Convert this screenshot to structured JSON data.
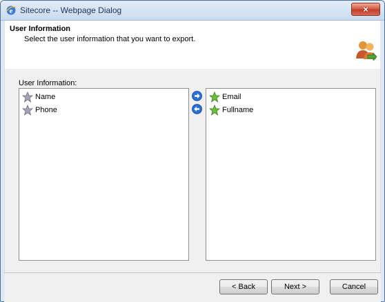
{
  "window": {
    "title": "Sitecore -- Webpage Dialog",
    "close_label": "×"
  },
  "header": {
    "title": "User Information",
    "description": "Select the user information that you want to export."
  },
  "section_label": "User Information:",
  "available_fields": [
    {
      "label": "Name",
      "icon": "star-gray-icon"
    },
    {
      "label": "Phone",
      "icon": "star-gray-icon"
    }
  ],
  "selected_fields": [
    {
      "label": "Email",
      "icon": "star-green-icon"
    },
    {
      "label": "Fullname",
      "icon": "star-green-icon"
    }
  ],
  "buttons": {
    "back": "< Back",
    "next": "Next >",
    "cancel": "Cancel"
  },
  "colors": {
    "title_bar": "#c9daf0",
    "close_button": "#c0392b",
    "arrow_button": "#2a6fd8",
    "star_gray": "#a7a4b6",
    "star_green": "#6cbf3b"
  }
}
